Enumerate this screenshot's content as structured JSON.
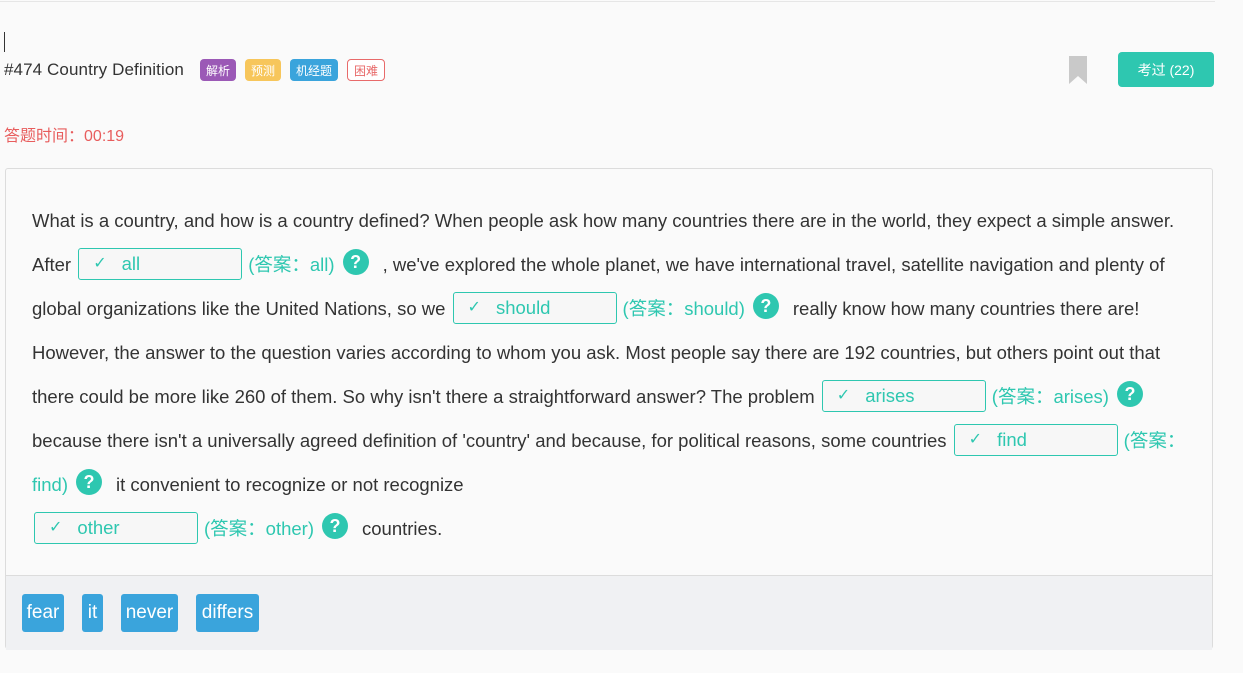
{
  "question": {
    "title": "#474 Country Definition",
    "tags": [
      "解析",
      "预测",
      "机经题",
      "困难"
    ]
  },
  "exam_button": "考过 (22)",
  "timer": {
    "label": "答题时间：",
    "value": "00:19"
  },
  "passage": {
    "s1": "What is a country, and how is a country defined? When people ask how many countries there are in the world, they expect a simple answer. After",
    "s2": ", we've explored the whole planet, we have international travel, satellite navigation and plenty of global organizations like the United Nations, so we",
    "s3": "really know how many countries there are! However, the answer to the question varies according to whom you ask. Most people say there are 192 countries, but others point out that there could be more like 260 of them. So why isn't there a straightforward answer? The problem",
    "s4": "because there isn't a universally agreed definition of 'country' and because, for political reasons, some countries",
    "s5": "it convenient to recognize or not recognize",
    "s6": "countries."
  },
  "blanks": [
    {
      "value": "all",
      "answer": "(答案：all)"
    },
    {
      "value": "should",
      "answer": "(答案：should)"
    },
    {
      "value": "arises",
      "answer": "(答案：arises)"
    },
    {
      "value": "find",
      "answer": "(答案：find)"
    },
    {
      "value": "other",
      "answer": "(答案：other)"
    }
  ],
  "check_glyph": "✓",
  "help_glyph": "?",
  "word_bank": [
    "fear",
    "it",
    "never",
    "differs"
  ],
  "icons": {
    "bookmark": "bookmark-icon",
    "check": "check-icon",
    "help": "help-icon"
  },
  "colors": {
    "accent": "#2ec7b0",
    "timer": "#e85d5d",
    "chip": "#3aa4dc",
    "tag_purple": "#9b59b6",
    "tag_yellow": "#f7c65b",
    "tag_blue": "#3aa4dc",
    "tag_red": "#e86a6a"
  }
}
